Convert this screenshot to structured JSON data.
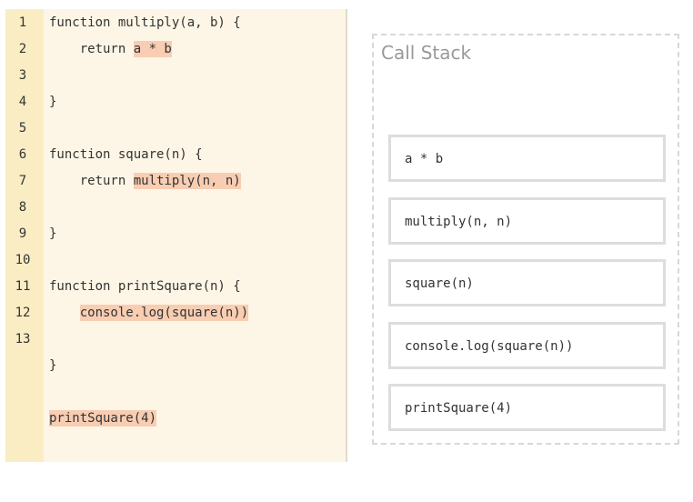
{
  "code_editor": {
    "line_numbers": [
      "1",
      "2",
      "3",
      "4",
      "5",
      "6",
      "7",
      "8",
      "9",
      "10",
      "11",
      "12",
      "13"
    ],
    "lines": [
      {
        "pre": "function multiply(a, b) {",
        "hl": "",
        "post": ""
      },
      {
        "pre": "    return ",
        "hl": "a * b",
        "post": ""
      },
      {
        "pre": "}",
        "hl": "",
        "post": ""
      },
      {
        "pre": "function square(n) {",
        "hl": "",
        "post": ""
      },
      {
        "pre": "    return ",
        "hl": "multiply(n, n)",
        "post": ""
      },
      {
        "pre": "}",
        "hl": "",
        "post": ""
      },
      {
        "pre": "function printSquare(n) {",
        "hl": "",
        "post": ""
      },
      {
        "pre": "    ",
        "hl": "console.log(square(n))",
        "post": ""
      },
      {
        "pre": "}",
        "hl": "",
        "post": ""
      },
      {
        "pre": "",
        "hl": "printSquare(4)",
        "post": ""
      }
    ]
  },
  "call_stack": {
    "title": "Call Stack",
    "items": [
      "a * b",
      "multiply(n, n)",
      "square(n)",
      "console.log(square(n))",
      "printSquare(4)"
    ]
  },
  "colors": {
    "code_background": "#fdf6e6",
    "gutter_background": "#faedc4",
    "highlight": "#f8cdb2",
    "stack_border": "#dddddd"
  }
}
